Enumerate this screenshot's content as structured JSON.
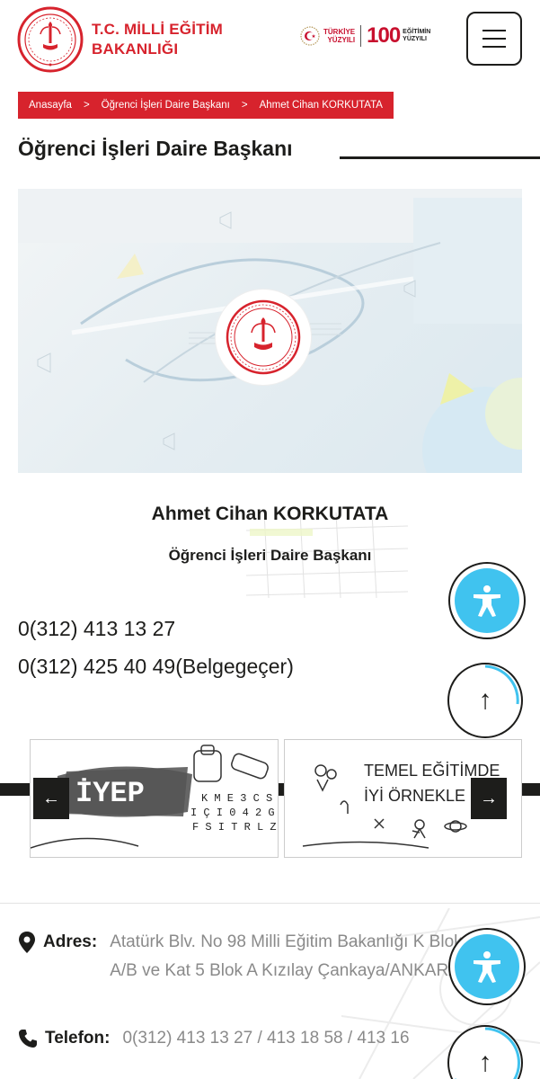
{
  "header": {
    "logo_line1": "T.C. MİLLİ EĞİTİM",
    "logo_line2": "BAKANLIĞI",
    "ty_line1": "TÜRKİYE",
    "ty_line2": "YÜZYILI",
    "hundred": "100",
    "hundred_sub1": "EĞİTİMİN",
    "hundred_sub2": "YÜZYILI",
    "brand_color": "#d7232d"
  },
  "breadcrumb": {
    "items": [
      "Anasayfa",
      "Öğrenci İşleri Daire Başkanı",
      "Ahmet Cihan KORKUTATA"
    ],
    "separator": ">"
  },
  "page": {
    "title": "Öğrenci İşleri Daire Başkanı"
  },
  "person": {
    "name": "Ahmet Cihan KORKUTATA",
    "position": "Öğrenci İşleri Daire Başkanı",
    "phone": "0(312) 413 13 27",
    "fax": "0(312) 425 40 49(Belgegeçer)"
  },
  "carousel": {
    "slide1_title": "İYEP",
    "slide1_letters": "K M E 3 C S Y\nI Ç I 0 4 2 G\nF S I T R L Z",
    "slide2_line1": "TEMEL EĞİTİMDE",
    "slide2_line2": "İYİ ÖRNEKLE",
    "prev_icon": "←",
    "next_icon": "→"
  },
  "footer": {
    "address_label": "Adres:",
    "address_value": "Atatürk Blv. No 98 Milli Eğitim Bakanlığı K Blok A/B ve Kat 5 Blok A Kızılay Çankaya/ANKARA",
    "phone_label": "Telefon:",
    "phone_value": "0(312) 413 13 27 / 413 18 58 / 413 16"
  },
  "floating": {
    "scroll_top_icon": "↑",
    "accessibility_color": "#40c3ef"
  }
}
